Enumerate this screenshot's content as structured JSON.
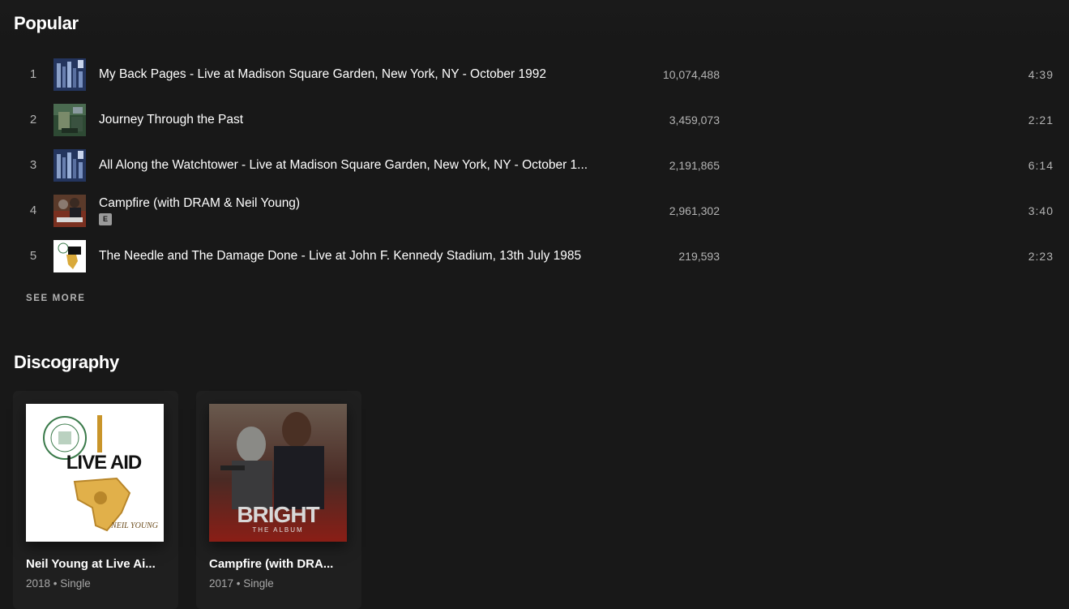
{
  "popular": {
    "title": "Popular",
    "see_more_label": "SEE MORE",
    "tracks": [
      {
        "number": "1",
        "title": "My Back Pages - Live at Madison Square Garden, New York, NY - October 1992",
        "plays": "10,074,488",
        "duration": "4:39",
        "explicit": false,
        "art_icon": "live-concert-album-art"
      },
      {
        "number": "2",
        "title": "Journey Through the Past",
        "plays": "3,459,073",
        "duration": "2:21",
        "explicit": false,
        "art_icon": "journey-album-art"
      },
      {
        "number": "3",
        "title": "All Along the Watchtower - Live at Madison Square Garden, New York, NY - October 1...",
        "plays": "2,191,865",
        "duration": "6:14",
        "explicit": false,
        "art_icon": "live-concert-album-art"
      },
      {
        "number": "4",
        "title": "Campfire (with DRAM & Neil Young)",
        "plays": "2,961,302",
        "duration": "3:40",
        "explicit": true,
        "explicit_label": "E",
        "art_icon": "bright-album-art"
      },
      {
        "number": "5",
        "title": "The Needle and The Damage Done - Live at John F. Kennedy Stadium, 13th July 1985",
        "plays": "219,593",
        "duration": "2:23",
        "explicit": false,
        "art_icon": "live-aid-album-art"
      }
    ]
  },
  "discography": {
    "title": "Discography",
    "albums": [
      {
        "title": "Neil Young at Live Ai...",
        "meta": "2018 • Single",
        "cover_icon": "live-aid-album-art",
        "cover_text_main": "LIVE AID",
        "cover_text_artist": "NEIL YOUNG"
      },
      {
        "title": "Campfire (with DRA...",
        "meta": "2017 • Single",
        "cover_icon": "bright-album-art",
        "cover_text_main": "BRIGHT",
        "cover_text_sub": "THE ALBUM"
      }
    ]
  },
  "colors": {
    "background": "#181818",
    "card": "#1f1f1f",
    "text_primary": "#ffffff",
    "text_secondary": "#b3b3b3"
  }
}
